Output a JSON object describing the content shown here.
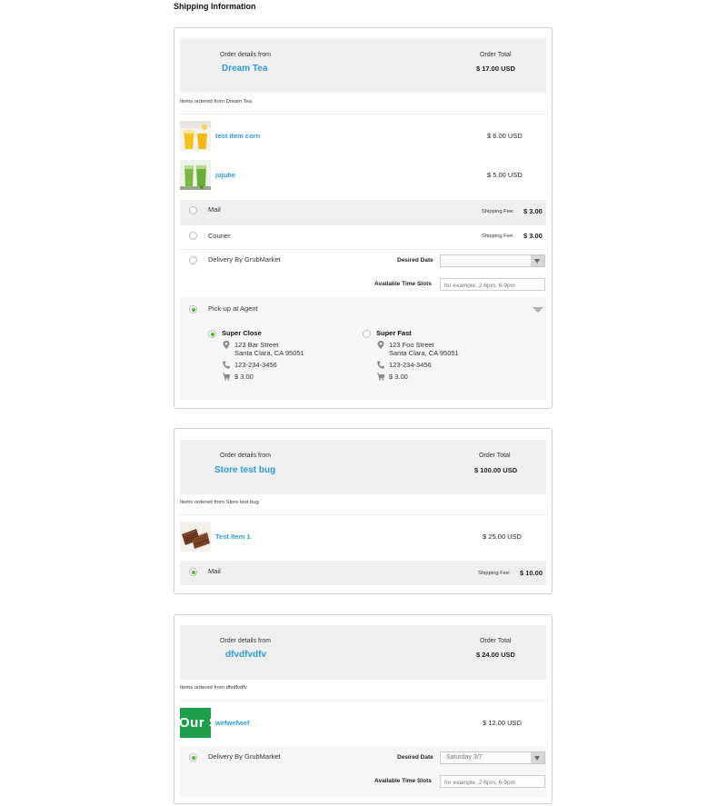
{
  "page": {
    "title": "Shipping Information"
  },
  "labels": {
    "order_details_from": "Order details from",
    "order_total": "Order Total",
    "shipping_fee": "Shipping Fee:",
    "desired_date": "Desired Date",
    "available_time_slots": "Available Time Slots",
    "time_slots_placeholder": "for example, 2-6pm, 6-9pm"
  },
  "orders": [
    {
      "store": "Dream Tea",
      "total": "$ 17.00 USD",
      "items_from": "Items ordered from Dream Tea",
      "items": [
        {
          "name": "test item corn",
          "price": "$ 6.00 USD",
          "thumb": "yellow-drink"
        },
        {
          "name": "jujube",
          "price": "$ 5.00 USD",
          "thumb": "green-drink"
        }
      ],
      "shipping": [
        {
          "label": "Mail",
          "fee": "$ 3.00",
          "selected": false
        },
        {
          "label": "Courier",
          "fee": "$ 3.00",
          "selected": false
        },
        {
          "label": "Delivery By GrubMarket",
          "desired_date": "",
          "selected": false
        },
        {
          "label": "Pick-up at Agent",
          "selected": true
        }
      ],
      "agents": [
        {
          "name": "Super Close",
          "address1": "123 Bar Street",
          "address2": "Santa Clara, CA 95051",
          "phone": "123-234-3456",
          "fee": "$ 3.00",
          "selected": true
        },
        {
          "name": "Super Fast",
          "address1": "123 Foo Street",
          "address2": "Santa Clara, CA 95051",
          "phone": "123-234-3456",
          "fee": "$ 3.00",
          "selected": false
        }
      ]
    },
    {
      "store": "Store test bug",
      "total": "$ 100.00 USD",
      "items_from": "Items ordered from Store test bug",
      "items": [
        {
          "name": "Test Item 1",
          "price": "$ 25.00 USD",
          "thumb": "chocolate-bars"
        }
      ],
      "shipping": [
        {
          "label": "Mail",
          "fee": "$ 10.00",
          "selected": true
        }
      ]
    },
    {
      "store": "dfvdfvdfv",
      "total": "$ 24.00 USD",
      "items_from": "Items ordered from dfvdfvdfv",
      "items": [
        {
          "name": "wefwefwef",
          "price": "$ 12.00 USD",
          "thumb": "green-logo",
          "thumb_text": "Our S"
        }
      ],
      "shipping": [
        {
          "label": "Delivery By GrubMarket",
          "desired_date": "Saturday 3/7",
          "selected": true
        }
      ]
    }
  ],
  "colors": {
    "accent_link": "#2e9bd6",
    "radio_selected": "#5bb130",
    "header_bg": "#efefef",
    "thumb_green": "#1c9e4b"
  },
  "icons": {
    "address": "map-pin-icon",
    "phone": "phone-icon",
    "fee": "cart-icon",
    "expand": "chevron-down-icon"
  }
}
